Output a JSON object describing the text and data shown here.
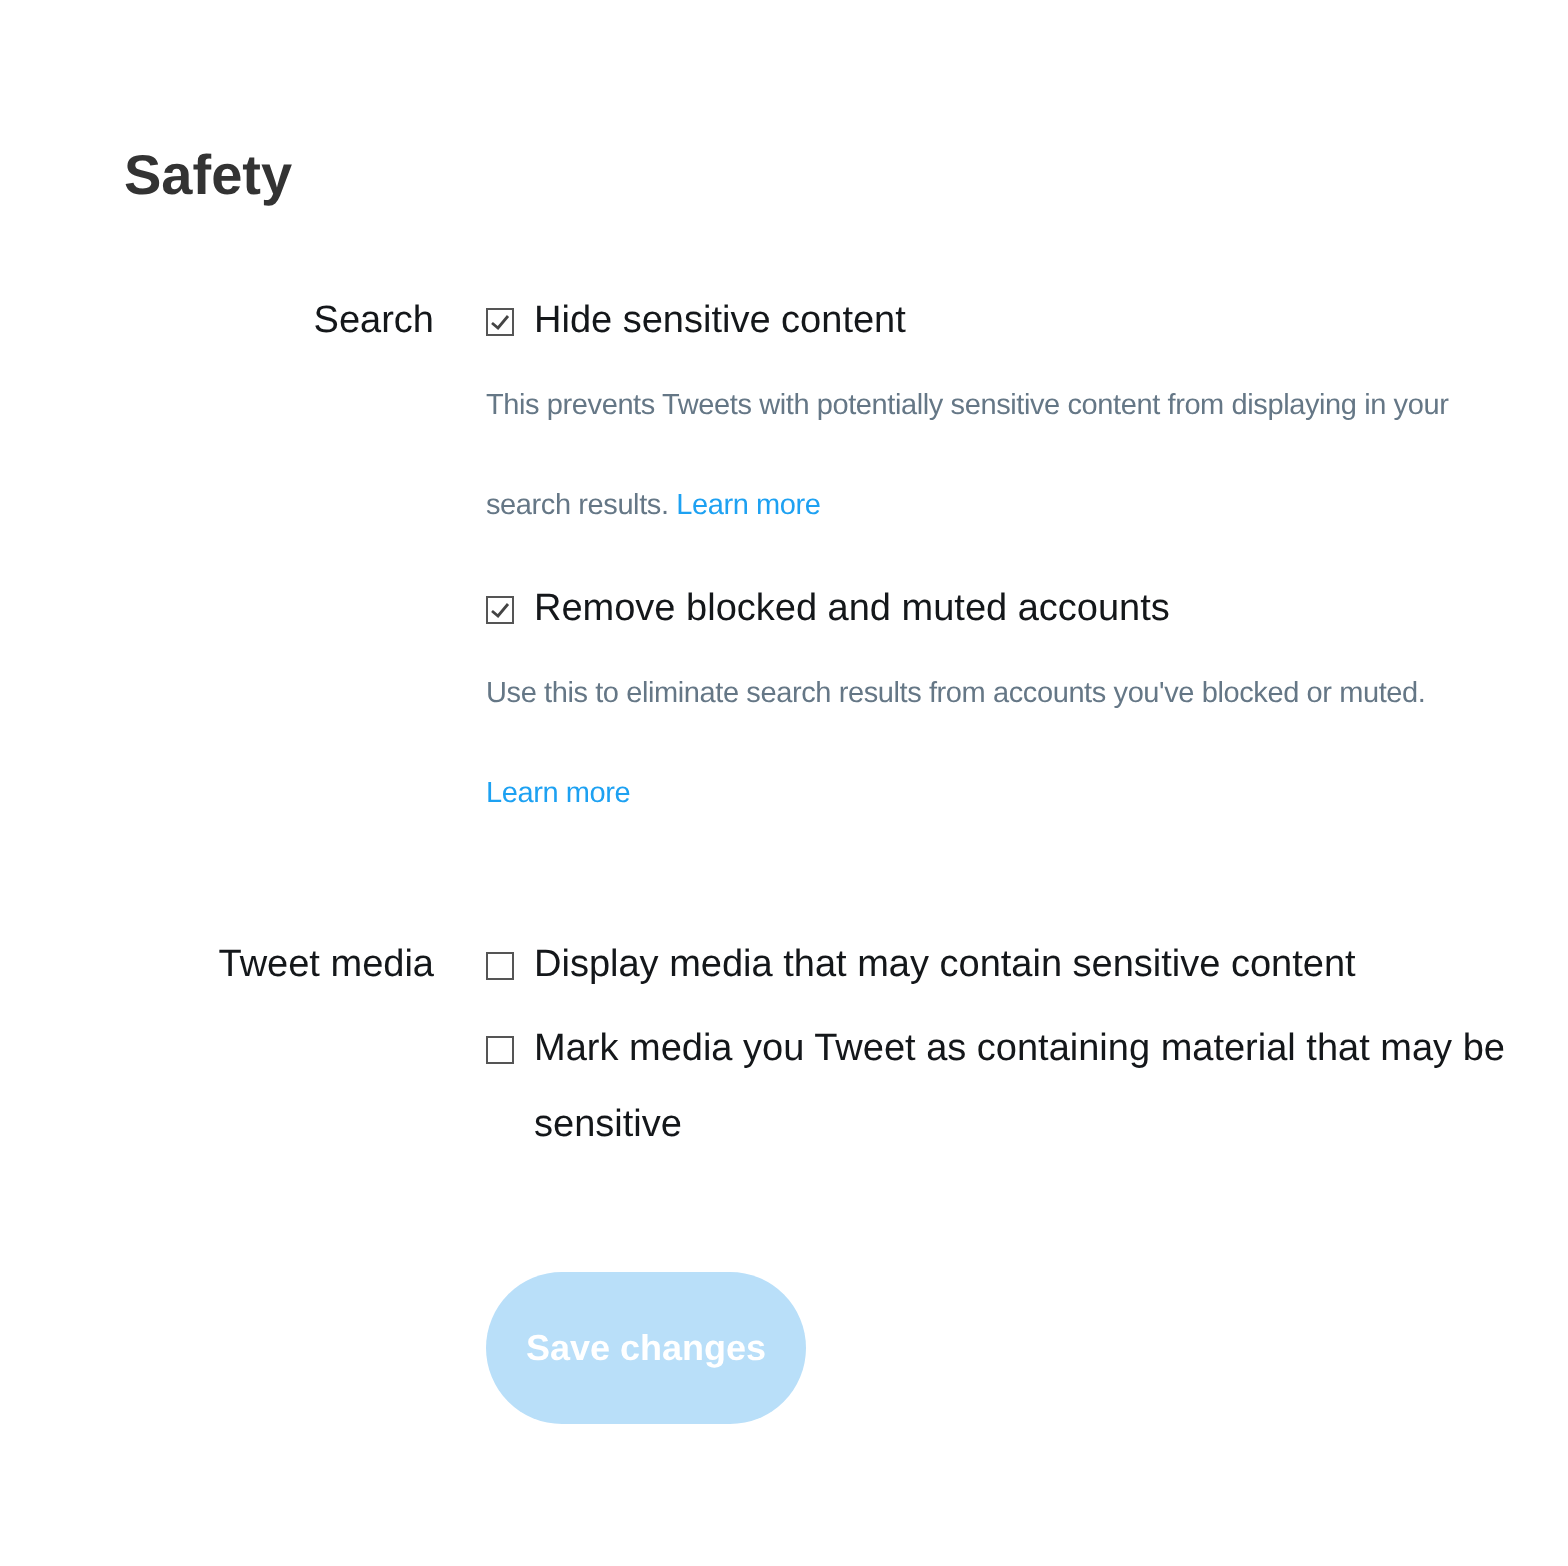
{
  "title": "Safety",
  "sections": [
    {
      "label": "Search",
      "options": [
        {
          "label": "Hide sensitive content",
          "checked": true,
          "description": "This prevents Tweets with potentially sensitive content from displaying in your search results.",
          "link": "Learn more"
        },
        {
          "label": "Remove blocked and muted accounts",
          "checked": true,
          "description": "Use this to eliminate search results from accounts you've blocked or muted.",
          "link": "Learn more"
        }
      ]
    },
    {
      "label": "Tweet media",
      "options": [
        {
          "label": "Display media that may contain sensitive content",
          "checked": false
        },
        {
          "label": "Mark media you Tweet as containing material that may be sensitive",
          "checked": false
        }
      ]
    }
  ],
  "button": {
    "label": "Save changes",
    "disabled": true
  }
}
